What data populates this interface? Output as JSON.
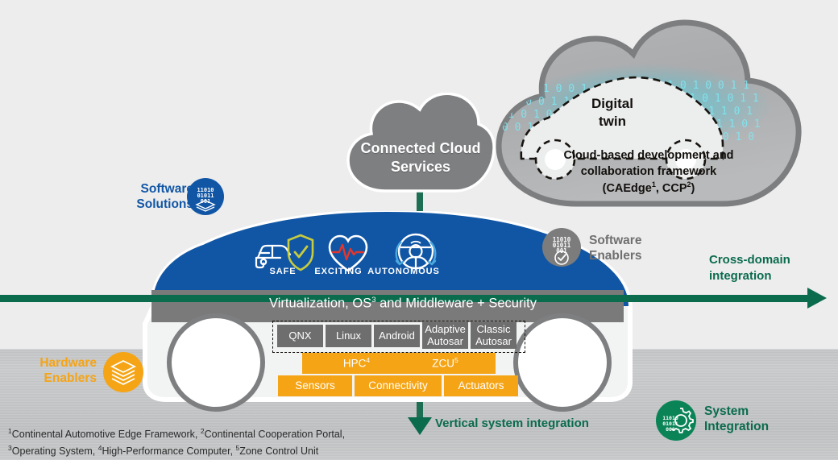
{
  "colors": {
    "blue": "#1156a5",
    "orange": "#f5a415",
    "grey": "#6e6e6e",
    "green": "#0a6b4d",
    "cyan": "#4fd8e8",
    "white": "#ffffff"
  },
  "clouds": {
    "connected": {
      "label": "Connected Cloud\nServices",
      "line1": "Connected Cloud",
      "line2": "Services"
    },
    "digital_twin": {
      "title_line1": "Digital",
      "title_line2": "twin"
    },
    "framework": {
      "line1": "Cloud-based development and",
      "line2": "collaboration framework",
      "line3_pre": "(CAEdge",
      "line3_sup1": "1",
      "line3_mid": ", CCP",
      "line3_sup2": "2",
      "line3_post": ")"
    }
  },
  "car": {
    "hood_icons": [
      {
        "name": "safe-icon",
        "label": "SAFE"
      },
      {
        "name": "exciting-icon",
        "label": "EXCITING"
      },
      {
        "name": "autonomous-icon",
        "label": "AUTONOMOUS"
      }
    ],
    "virtualization_bar": {
      "pre": "Virtualization, OS",
      "sup": "3",
      "post": " and Middleware + Security"
    },
    "os_boxes": [
      {
        "label": "QNX"
      },
      {
        "label": "Linux"
      },
      {
        "label": "Android"
      },
      {
        "label": "Adaptive\nAutosar",
        "line1": "Adaptive",
        "line2": "Autosar"
      },
      {
        "label": "Classic\nAutosar",
        "line1": "Classic",
        "line2": "Autosar"
      }
    ],
    "compute_boxes": [
      {
        "label": "HPC",
        "sup": "4"
      },
      {
        "label": "ZCU",
        "sup": "5"
      }
    ],
    "hardware_boxes": [
      {
        "label": "Sensors"
      },
      {
        "label": "Connectivity"
      },
      {
        "label": "Actuators"
      }
    ]
  },
  "badges": {
    "software_solutions": {
      "line1": "Software",
      "line2": "Solutions",
      "icon": "binary-layers-icon"
    },
    "software_enablers": {
      "line1": "Software",
      "line2": "Enablers",
      "icon": "binary-check-icon"
    },
    "hardware_enablers": {
      "line1": "Hardware",
      "line2": "Enablers",
      "icon": "layers-icon"
    },
    "system_integration": {
      "line1": "System",
      "line2": "Integration",
      "icon": "binary-gear-icon"
    }
  },
  "arrows": {
    "cross_domain": {
      "line1": "Cross-domain",
      "line2": "integration"
    },
    "vertical": {
      "label": "Vertical system integration"
    }
  },
  "footnotes": {
    "line1_pre": "",
    "items": [
      {
        "sup": "1",
        "text": "Continental Automotive Edge Framework,"
      },
      {
        "sup": "2",
        "text": "Continental Cooperation Portal,"
      },
      {
        "sup": "3",
        "text": "Operating System,"
      },
      {
        "sup": "4",
        "text": "High-Performance Computer,"
      },
      {
        "sup": "5",
        "text": "Zone Control Unit"
      }
    ]
  }
}
